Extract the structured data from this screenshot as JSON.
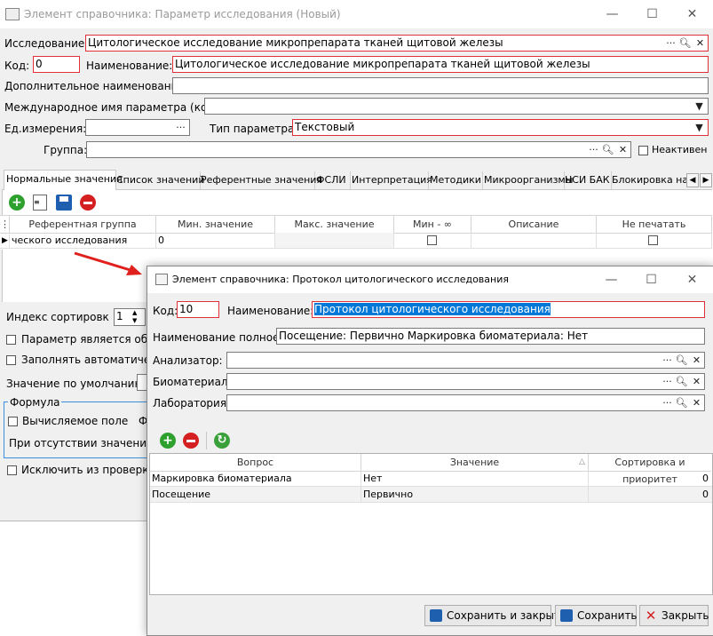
{
  "main": {
    "title": "Элемент справочника: Параметр исследования (Новый)",
    "label_research": "Исследование:",
    "research_value": "Цитологическое исследование микропрепарата тканей щитовой железы",
    "label_code": "Код:",
    "code_value": "0",
    "label_name": "Наименование:",
    "name_value": "Цитологическое исследование микропрепарата тканей щитовой железы",
    "label_extra_name": "Дополнительное наименование:",
    "label_intl_name": "Международное имя параметра (код):",
    "label_unit": "Ед.измерения:",
    "label_param_type": "Тип параметра:",
    "param_type_value": "Текстовый",
    "label_group": "Группа:",
    "label_inactive": "Неактивен",
    "tabs": [
      "Нормальные значения",
      "Список значений",
      "Референтные значения",
      "ФСЛИ",
      "Интерпретация",
      "Методики",
      "Микроорганизмы",
      "НСИ БАК",
      "Блокировка на:"
    ],
    "grid_headers": [
      "Референтная группа",
      "Мин. значение",
      "Макс. значение",
      "Мин - ∞",
      "Описание",
      "Не печатать"
    ],
    "grid_row": {
      "group": "ческого исследования",
      "min": "0"
    },
    "label_sort_index": "Индекс сортировк",
    "sort_index_value": "1",
    "label_param_is": "Параметр является обяз",
    "label_fill_auto": "Заполнять автоматическ",
    "label_default": "Значение по умолчанию:",
    "formula_legend": "Формула",
    "label_computed": "Вычисляемое поле",
    "formula_f": "Ф",
    "label_absence": "При отсутствии значения з",
    "label_exclude": "Исключить из проверки"
  },
  "dialog": {
    "title": "Элемент справочника: Протокол цитологического исследования",
    "label_code": "Код:",
    "code_value": "10",
    "label_name": "Наименование:",
    "name_value": "Протокол цитологического исследования",
    "label_full_name": "Наименование полное:",
    "full_name_value": "Посещение: Первично Маркировка биоматериала: Нет",
    "label_analyzer": "Анализатор:",
    "label_biomaterial": "Биоматериал:",
    "label_lab": "Лаборатория:",
    "grid_headers": [
      "Вопрос",
      "Значение",
      "Сортировка и приоритет"
    ],
    "rows": [
      {
        "question": "Маркировка биоматериала",
        "value": "Нет",
        "sort": "0"
      },
      {
        "question": "Посещение",
        "value": "Первично",
        "sort": "0"
      }
    ],
    "btn_save_close": "Сохранить и закрыть",
    "btn_save": "Сохранить",
    "btn_close": "Закрыть"
  },
  "colors": {
    "required_border": "#e0303a",
    "arrow": "#e0201c",
    "add": "#2ea02e",
    "remove": "#d42020",
    "selection": "#0078d7"
  }
}
